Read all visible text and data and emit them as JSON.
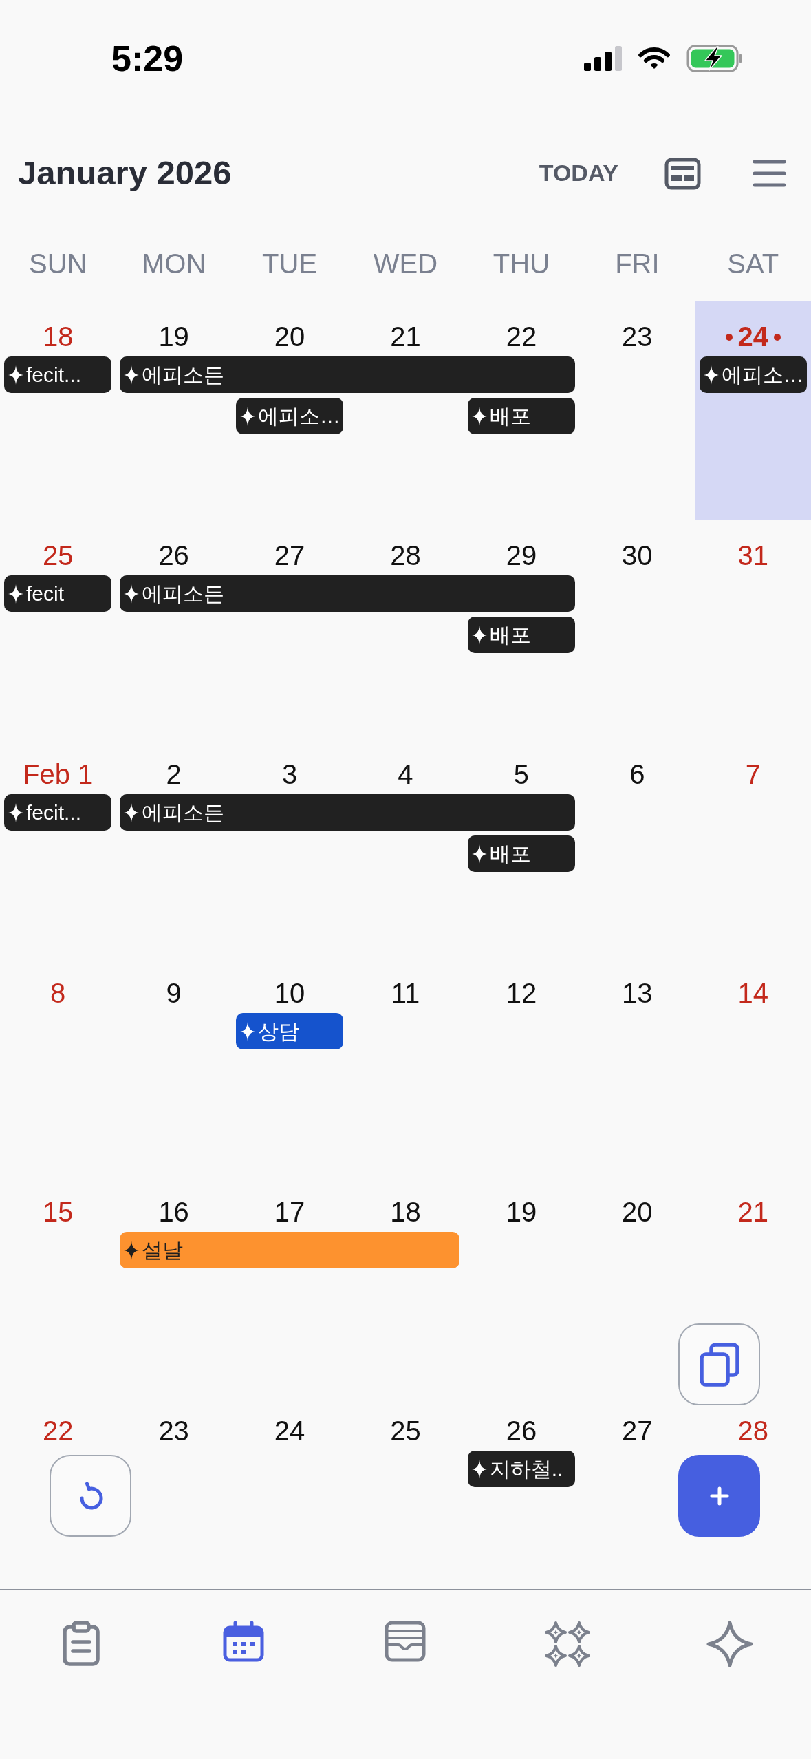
{
  "status_bar": {
    "time": "5:29"
  },
  "header": {
    "title": "January 2026",
    "today_button": "TODAY"
  },
  "weekdays": [
    "SUN",
    "MON",
    "TUE",
    "WED",
    "THU",
    "FRI",
    "SAT"
  ],
  "weeks": [
    {
      "days": [
        {
          "label": "18",
          "today": false,
          "bars": [
            {
              "kind": "start",
              "title": "fecit...",
              "color": "#212121"
            }
          ]
        },
        {
          "label": "19",
          "today": false,
          "bars": [
            {
              "kind": "start",
              "title": "에피소든",
              "color": "#212121"
            }
          ]
        },
        {
          "label": "20",
          "today": false,
          "bars": [
            {
              "kind": "more"
            },
            {
              "kind": "start",
              "title": "에피소…",
              "color": "#212121"
            }
          ]
        },
        {
          "label": "21",
          "today": false,
          "bars": [
            {
              "kind": "more"
            }
          ]
        },
        {
          "label": "22",
          "today": false,
          "bars": [
            {
              "kind": "more"
            },
            {
              "kind": "start",
              "title": "배포",
              "color": "#212121"
            }
          ]
        },
        {
          "label": "23",
          "today": false
        },
        {
          "label": "24",
          "today": true,
          "bars": [
            {
              "kind": "start",
              "title": "에피소…",
              "color": "#212121"
            }
          ]
        }
      ]
    },
    {
      "days": [
        {
          "label": "25",
          "today": false,
          "bars": [
            {
              "kind": "start",
              "title": "fecit",
              "color": "#212121"
            }
          ]
        },
        {
          "label": "26",
          "today": false,
          "bars": [
            {
              "kind": "start",
              "title": "에피소든",
              "color": "#212121"
            }
          ]
        },
        {
          "label": "27",
          "today": false,
          "bars": [
            {
              "kind": "more"
            }
          ]
        },
        {
          "label": "28",
          "today": false,
          "bars": [
            {
              "kind": "more"
            }
          ]
        },
        {
          "label": "29",
          "today": false,
          "bars": [
            {
              "kind": "more"
            },
            {
              "kind": "start",
              "title": "배포",
              "color": "#212121"
            }
          ]
        },
        {
          "label": "30",
          "today": false
        },
        {
          "label": "31",
          "today": false
        }
      ]
    },
    {
      "days": [
        {
          "label": "Feb 1",
          "today": false,
          "bars": [
            {
              "kind": "start",
              "title": "fecit...",
              "color": "#212121"
            }
          ]
        },
        {
          "label": "2",
          "today": false,
          "bars": [
            {
              "kind": "start",
              "title": "에피소든",
              "color": "#212121"
            }
          ]
        },
        {
          "label": "3",
          "today": false,
          "bars": [
            {
              "kind": "more"
            }
          ]
        },
        {
          "label": "4",
          "today": false,
          "bars": [
            {
              "kind": "more"
            }
          ]
        },
        {
          "label": "5",
          "today": false,
          "bars": [
            {
              "kind": "more"
            },
            {
              "kind": "start",
              "title": "배포",
              "color": "#212121"
            }
          ]
        },
        {
          "label": "6",
          "today": false
        },
        {
          "label": "7",
          "today": false
        }
      ]
    },
    {
      "days": [
        {
          "label": "8",
          "today": false
        },
        {
          "label": "9",
          "today": false
        },
        {
          "label": "10",
          "today": false,
          "bars": [
            {
              "kind": "start",
              "title": "상담",
              "color": "#1553cd"
            }
          ]
        },
        {
          "label": "11",
          "today": false
        },
        {
          "label": "12",
          "today": false
        },
        {
          "label": "13",
          "today": false
        },
        {
          "label": "14",
          "today": false
        }
      ]
    },
    {
      "days": [
        {
          "label": "15",
          "today": false
        },
        {
          "label": "16",
          "today": false,
          "bars": [
            {
              "kind": "start",
              "title": "설날",
              "color": "#fd922f"
            }
          ]
        },
        {
          "label": "17",
          "today": false,
          "bars": [
            {
              "kind": "more"
            }
          ]
        },
        {
          "label": "18",
          "today": false,
          "bars": [
            {
              "kind": "more"
            }
          ]
        },
        {
          "label": "19",
          "today": false
        },
        {
          "label": "20",
          "today": false
        },
        {
          "label": "21",
          "today": false
        }
      ]
    },
    {
      "days": [
        {
          "label": "22",
          "today": false
        },
        {
          "label": "23",
          "today": false
        },
        {
          "label": "24",
          "today": false
        },
        {
          "label": "25",
          "today": false
        },
        {
          "label": "26",
          "today": false,
          "bars": [
            {
              "kind": "start",
              "title": "지하철..",
              "color": "#212121"
            }
          ]
        },
        {
          "label": "27",
          "today": false
        },
        {
          "label": "28",
          "today": false
        }
      ]
    }
  ],
  "tab_bar": {
    "tabs": [
      {
        "selected": false
      },
      {
        "selected": true
      },
      {
        "selected": false
      },
      {
        "selected": false
      },
      {
        "selected": false
      }
    ]
  }
}
